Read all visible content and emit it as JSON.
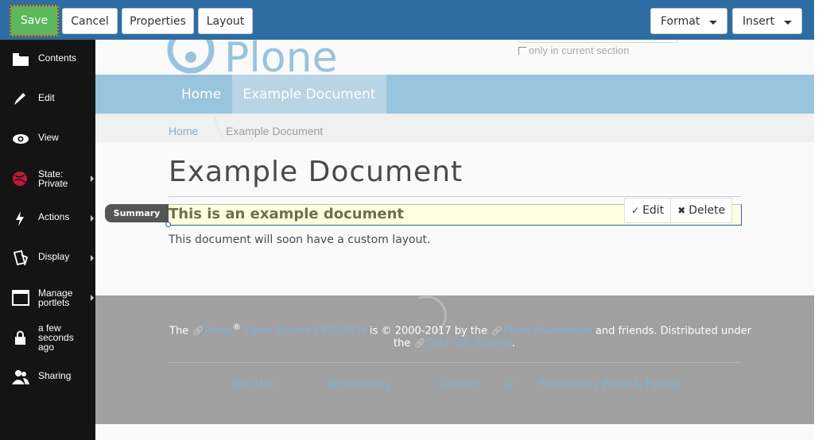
{
  "toolbar": {
    "save_label": "Save",
    "cancel_label": "Cancel",
    "properties_label": "Properties",
    "layout_label": "Layout",
    "format_label": "Format",
    "insert_label": "Insert"
  },
  "sidebar": {
    "items": [
      {
        "label": "Contents",
        "icon": "folder-icon"
      },
      {
        "label": "Edit",
        "icon": "pencil-icon"
      },
      {
        "label": "View",
        "icon": "eye-icon"
      },
      {
        "label_line1": "State:",
        "label_line2": "Private",
        "icon": "state-icon"
      },
      {
        "label": "Actions",
        "icon": "bolt-icon"
      },
      {
        "label": "Display",
        "icon": "display-icon"
      },
      {
        "label_line1": "Manage",
        "label_line2": "portlets",
        "icon": "portlet-icon"
      },
      {
        "label_line1": "a few",
        "label_line2": "seconds",
        "label_line3": "ago",
        "icon": "lock-icon"
      },
      {
        "label": "Sharing",
        "icon": "users-icon"
      }
    ]
  },
  "site": {
    "logo_text": "Plone",
    "search_option": "only in current section"
  },
  "nav": {
    "home": "Home",
    "current": "Example Document"
  },
  "breadcrumb": {
    "home": "Home",
    "current": "Example Document"
  },
  "document": {
    "title": "Example Document",
    "summary_tag": "Summary",
    "summary": "This is an example document",
    "body": "This document will soon have a custom layout.",
    "tile_edit": "Edit",
    "tile_delete": "Delete"
  },
  "footer": {
    "the": "The",
    "plone": "Plone",
    "reg": "®",
    "cms": "Open Source CMS/WCM",
    "copyright": "is © 2000-2017 by the",
    "foundation": "Plone Foundation",
    "friends": "and friends. Distributed under",
    "the2": "the",
    "license": "GNU GPL license",
    "period": ".",
    "links": {
      "sitemap": "Site Map",
      "accessibility": "Accessibility",
      "contact": "Contact",
      "powered": "Powered by Plone & Python"
    }
  },
  "colors": {
    "toolbar": "#2e6da4",
    "save": "#5cb85c",
    "sidebar": "#141414",
    "nav": "#98c4dd",
    "link": "#7fb1d0",
    "footer": "#a0a0a0"
  }
}
